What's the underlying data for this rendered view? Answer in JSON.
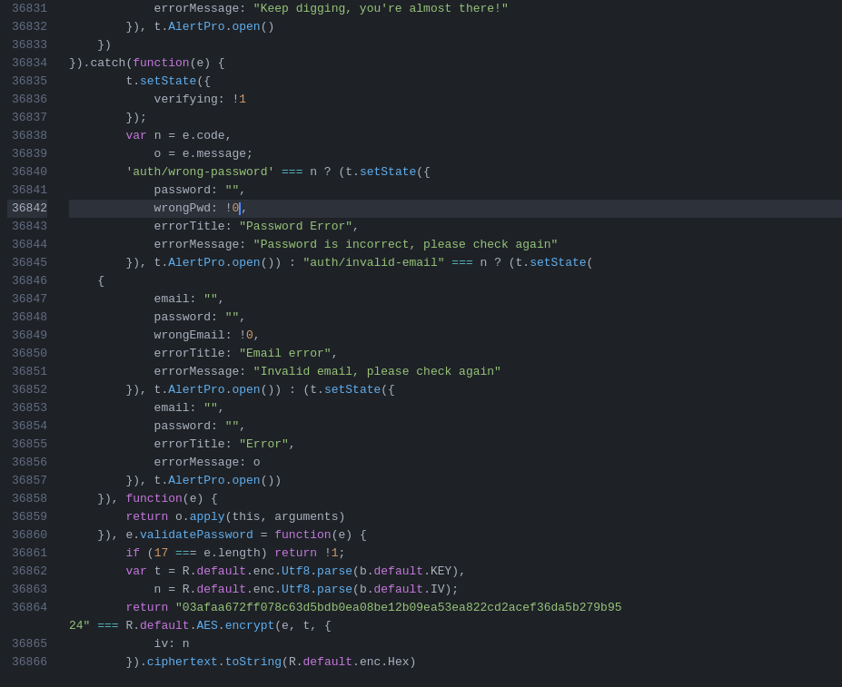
{
  "editor": {
    "background": "#1e2227",
    "active_line": 36842,
    "lines": [
      {
        "num": 36831,
        "active": false,
        "tokens": [
          {
            "t": "            errorMessage: ",
            "c": "plain"
          },
          {
            "t": "\"Keep digging, you're almost there!\"",
            "c": "str"
          }
        ]
      },
      {
        "num": 36832,
        "active": false,
        "tokens": [
          {
            "t": "        }), t.",
            "c": "plain"
          },
          {
            "t": "AlertPro",
            "c": "fn"
          },
          {
            "t": ".",
            "c": "plain"
          },
          {
            "t": "open",
            "c": "fn"
          },
          {
            "t": "()",
            "c": "plain"
          }
        ]
      },
      {
        "num": 36833,
        "active": false,
        "tokens": [
          {
            "t": "    })",
            "c": "plain"
          }
        ]
      },
      {
        "num": 36834,
        "active": false,
        "tokens": [
          {
            "t": "}).catch(",
            "c": "plain"
          },
          {
            "t": "function",
            "c": "kw"
          },
          {
            "t": "(e) {",
            "c": "plain"
          }
        ]
      },
      {
        "num": 36835,
        "active": false,
        "tokens": [
          {
            "t": "        t.",
            "c": "plain"
          },
          {
            "t": "setState",
            "c": "fn"
          },
          {
            "t": "({",
            "c": "plain"
          }
        ]
      },
      {
        "num": 36836,
        "active": false,
        "tokens": [
          {
            "t": "            verifying: !",
            "c": "plain"
          },
          {
            "t": "1",
            "c": "num"
          }
        ]
      },
      {
        "num": 36837,
        "active": false,
        "tokens": [
          {
            "t": "        });",
            "c": "plain"
          }
        ]
      },
      {
        "num": 36838,
        "active": false,
        "tokens": [
          {
            "t": "        ",
            "c": "plain"
          },
          {
            "t": "var",
            "c": "kw"
          },
          {
            "t": " n = e.code,",
            "c": "plain"
          }
        ]
      },
      {
        "num": 36839,
        "active": false,
        "tokens": [
          {
            "t": "            o = e.message;",
            "c": "plain"
          }
        ]
      },
      {
        "num": 36840,
        "active": false,
        "tokens": [
          {
            "t": "        'auth/wrong-password' ",
            "c": "str"
          },
          {
            "t": "===",
            "c": "op"
          },
          {
            "t": " n ? (t.",
            "c": "plain"
          },
          {
            "t": "setState",
            "c": "fn"
          },
          {
            "t": "({",
            "c": "plain"
          }
        ]
      },
      {
        "num": 36841,
        "active": false,
        "tokens": [
          {
            "t": "            password: ",
            "c": "plain"
          },
          {
            "t": "\"\"",
            "c": "str"
          },
          {
            "t": ",",
            "c": "plain"
          }
        ]
      },
      {
        "num": 36842,
        "active": true,
        "tokens": [
          {
            "t": "            wrongPwd: !",
            "c": "plain"
          },
          {
            "t": "0",
            "c": "num"
          },
          {
            "t": "CURSOR",
            "c": "cursor"
          },
          {
            "t": ",",
            "c": "plain"
          }
        ]
      },
      {
        "num": 36843,
        "active": false,
        "tokens": [
          {
            "t": "            errorTitle: ",
            "c": "plain"
          },
          {
            "t": "\"Password Error\"",
            "c": "str"
          },
          {
            "t": ",",
            "c": "plain"
          }
        ]
      },
      {
        "num": 36844,
        "active": false,
        "tokens": [
          {
            "t": "            errorMessage: ",
            "c": "plain"
          },
          {
            "t": "\"Password is incorrect, please check again\"",
            "c": "str"
          }
        ]
      },
      {
        "num": 36845,
        "active": false,
        "tokens": [
          {
            "t": "        }), t.",
            "c": "plain"
          },
          {
            "t": "AlertPro",
            "c": "fn"
          },
          {
            "t": ".",
            "c": "plain"
          },
          {
            "t": "open",
            "c": "fn"
          },
          {
            "t": "()) : ",
            "c": "plain"
          },
          {
            "t": "\"auth/invalid-email\"",
            "c": "str"
          },
          {
            "t": " ",
            "c": "plain"
          },
          {
            "t": "===",
            "c": "op"
          },
          {
            "t": " n ? (t.",
            "c": "plain"
          },
          {
            "t": "setState",
            "c": "fn"
          },
          {
            "t": "(",
            "c": "plain"
          }
        ]
      },
      {
        "num": 36846,
        "active": false,
        "tokens": [
          {
            "t": "    {",
            "c": "plain"
          }
        ]
      },
      {
        "num": 36847,
        "active": false,
        "tokens": [
          {
            "t": "            email: ",
            "c": "plain"
          },
          {
            "t": "\"\"",
            "c": "str"
          },
          {
            "t": ",",
            "c": "plain"
          }
        ]
      },
      {
        "num": 36848,
        "active": false,
        "tokens": [
          {
            "t": "            password: ",
            "c": "plain"
          },
          {
            "t": "\"\"",
            "c": "str"
          },
          {
            "t": ",",
            "c": "plain"
          }
        ]
      },
      {
        "num": 36849,
        "active": false,
        "tokens": [
          {
            "t": "            wrongEmail: !",
            "c": "plain"
          },
          {
            "t": "0",
            "c": "num"
          },
          {
            "t": ",",
            "c": "plain"
          }
        ]
      },
      {
        "num": 36850,
        "active": false,
        "tokens": [
          {
            "t": "            errorTitle: ",
            "c": "plain"
          },
          {
            "t": "\"Email error\"",
            "c": "str"
          },
          {
            "t": ",",
            "c": "plain"
          }
        ]
      },
      {
        "num": 36851,
        "active": false,
        "tokens": [
          {
            "t": "            errorMessage: ",
            "c": "plain"
          },
          {
            "t": "\"Invalid email, please check again\"",
            "c": "str"
          }
        ]
      },
      {
        "num": 36852,
        "active": false,
        "tokens": [
          {
            "t": "        }), t.",
            "c": "plain"
          },
          {
            "t": "AlertPro",
            "c": "fn"
          },
          {
            "t": ".",
            "c": "plain"
          },
          {
            "t": "open",
            "c": "fn"
          },
          {
            "t": "()) : (t.",
            "c": "plain"
          },
          {
            "t": "setState",
            "c": "fn"
          },
          {
            "t": "({",
            "c": "plain"
          }
        ]
      },
      {
        "num": 36853,
        "active": false,
        "tokens": [
          {
            "t": "            email: ",
            "c": "plain"
          },
          {
            "t": "\"\"",
            "c": "str"
          },
          {
            "t": ",",
            "c": "plain"
          }
        ]
      },
      {
        "num": 36854,
        "active": false,
        "tokens": [
          {
            "t": "            password: ",
            "c": "plain"
          },
          {
            "t": "\"\"",
            "c": "str"
          },
          {
            "t": ",",
            "c": "plain"
          }
        ]
      },
      {
        "num": 36855,
        "active": false,
        "tokens": [
          {
            "t": "            errorTitle: ",
            "c": "plain"
          },
          {
            "t": "\"Error\"",
            "c": "str"
          },
          {
            "t": ",",
            "c": "plain"
          }
        ]
      },
      {
        "num": 36856,
        "active": false,
        "tokens": [
          {
            "t": "            errorMessage: o",
            "c": "plain"
          }
        ]
      },
      {
        "num": 36857,
        "active": false,
        "tokens": [
          {
            "t": "        }), t.",
            "c": "plain"
          },
          {
            "t": "AlertPro",
            "c": "fn"
          },
          {
            "t": ".",
            "c": "plain"
          },
          {
            "t": "open",
            "c": "fn"
          },
          {
            "t": "())",
            "c": "plain"
          }
        ]
      },
      {
        "num": 36858,
        "active": false,
        "tokens": [
          {
            "t": "    }), ",
            "c": "plain"
          },
          {
            "t": "function",
            "c": "kw"
          },
          {
            "t": "(e) {",
            "c": "plain"
          }
        ]
      },
      {
        "num": 36859,
        "active": false,
        "tokens": [
          {
            "t": "        ",
            "c": "plain"
          },
          {
            "t": "return",
            "c": "kw"
          },
          {
            "t": " o.",
            "c": "plain"
          },
          {
            "t": "apply",
            "c": "fn"
          },
          {
            "t": "(this, arguments)",
            "c": "plain"
          }
        ]
      },
      {
        "num": 36860,
        "active": false,
        "tokens": [
          {
            "t": "    }), e.",
            "c": "plain"
          },
          {
            "t": "validatePassword",
            "c": "fn"
          },
          {
            "t": " = ",
            "c": "plain"
          },
          {
            "t": "function",
            "c": "kw"
          },
          {
            "t": "(e) {",
            "c": "plain"
          }
        ]
      },
      {
        "num": 36861,
        "active": false,
        "tokens": [
          {
            "t": "        ",
            "c": "plain"
          },
          {
            "t": "if",
            "c": "kw"
          },
          {
            "t": " (",
            "c": "plain"
          },
          {
            "t": "17",
            "c": "num"
          },
          {
            "t": " ",
            "c": "plain"
          },
          {
            "t": "==",
            "c": "op"
          },
          {
            "t": "= e.length) ",
            "c": "plain"
          },
          {
            "t": "return",
            "c": "kw"
          },
          {
            "t": " !",
            "c": "plain"
          },
          {
            "t": "1",
            "c": "num"
          },
          {
            "t": ";",
            "c": "plain"
          }
        ]
      },
      {
        "num": 36862,
        "active": false,
        "tokens": [
          {
            "t": "        ",
            "c": "plain"
          },
          {
            "t": "var",
            "c": "kw"
          },
          {
            "t": " t = R.",
            "c": "plain"
          },
          {
            "t": "default",
            "c": "kw"
          },
          {
            "t": ".enc.",
            "c": "plain"
          },
          {
            "t": "Utf8",
            "c": "fn"
          },
          {
            "t": ".",
            "c": "plain"
          },
          {
            "t": "parse",
            "c": "fn"
          },
          {
            "t": "(b.",
            "c": "plain"
          },
          {
            "t": "default",
            "c": "kw"
          },
          {
            "t": ".KEY),",
            "c": "plain"
          }
        ]
      },
      {
        "num": 36863,
        "active": false,
        "tokens": [
          {
            "t": "            n = R.",
            "c": "plain"
          },
          {
            "t": "default",
            "c": "kw"
          },
          {
            "t": ".enc.",
            "c": "plain"
          },
          {
            "t": "Utf8",
            "c": "fn"
          },
          {
            "t": ".",
            "c": "plain"
          },
          {
            "t": "parse",
            "c": "fn"
          },
          {
            "t": "(b.",
            "c": "plain"
          },
          {
            "t": "default",
            "c": "kw"
          },
          {
            "t": ".IV);",
            "c": "plain"
          }
        ]
      },
      {
        "num": 36864,
        "active": false,
        "tokens": [
          {
            "t": "        ",
            "c": "plain"
          },
          {
            "t": "return",
            "c": "kw"
          },
          {
            "t": " ",
            "c": "plain"
          },
          {
            "t": "\"03afaa672ff078c63d5bdb0ea08be12b09ea53ea822cd2acef36da5b279b95",
            "c": "str"
          }
        ]
      },
      {
        "num": -1,
        "active": false,
        "tokens": [
          {
            "t": "24\"",
            "c": "str"
          },
          {
            "t": " ",
            "c": "plain"
          },
          {
            "t": "===",
            "c": "op"
          },
          {
            "t": " R.",
            "c": "plain"
          },
          {
            "t": "default",
            "c": "kw"
          },
          {
            "t": ".",
            "c": "plain"
          },
          {
            "t": "AES",
            "c": "fn"
          },
          {
            "t": ".",
            "c": "plain"
          },
          {
            "t": "encrypt",
            "c": "fn"
          },
          {
            "t": "(e, t, {",
            "c": "plain"
          }
        ]
      },
      {
        "num": 36865,
        "active": false,
        "tokens": [
          {
            "t": "            iv: n",
            "c": "plain"
          }
        ]
      },
      {
        "num": 36866,
        "active": false,
        "tokens": [
          {
            "t": "        }).",
            "c": "plain"
          },
          {
            "t": "ciphertext",
            "c": "fn"
          },
          {
            "t": ".",
            "c": "plain"
          },
          {
            "t": "toString",
            "c": "fn"
          },
          {
            "t": "(R.",
            "c": "plain"
          },
          {
            "t": "default",
            "c": "kw"
          },
          {
            "t": ".enc.Hex)",
            "c": "plain"
          }
        ]
      }
    ]
  }
}
